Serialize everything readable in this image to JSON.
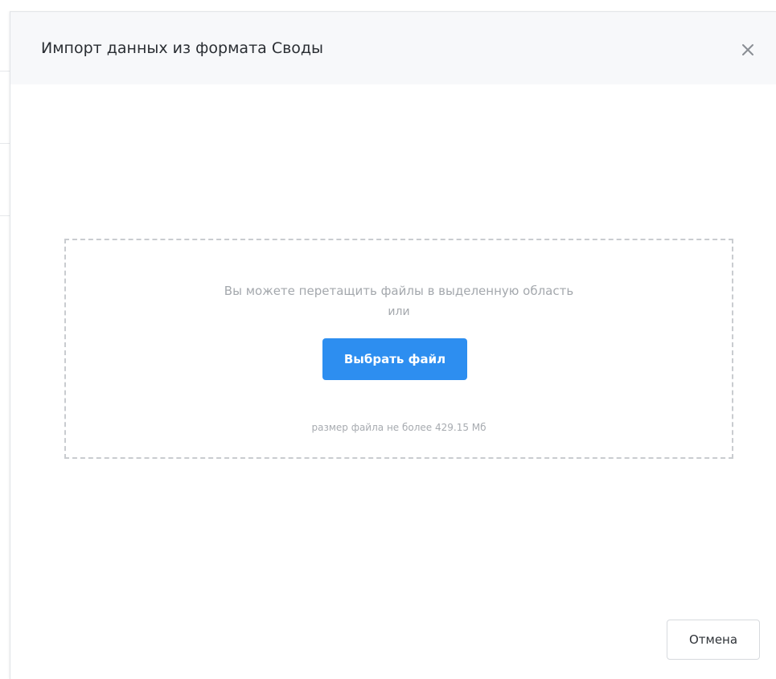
{
  "modal": {
    "title": "Импорт данных из формата Своды",
    "close_icon": "close-icon"
  },
  "dropzone": {
    "hint": "Вы можете перетащить файлы в выделенную область",
    "or": "или",
    "choose_button": "Выбрать файл",
    "size_limit": "размер файла не более 429.15 Мб"
  },
  "footer": {
    "cancel_button": "Отмена"
  },
  "colors": {
    "accent": "#2d8ef0",
    "header_bg": "#f7f8fa",
    "dashed_border": "#c9ccd0"
  }
}
